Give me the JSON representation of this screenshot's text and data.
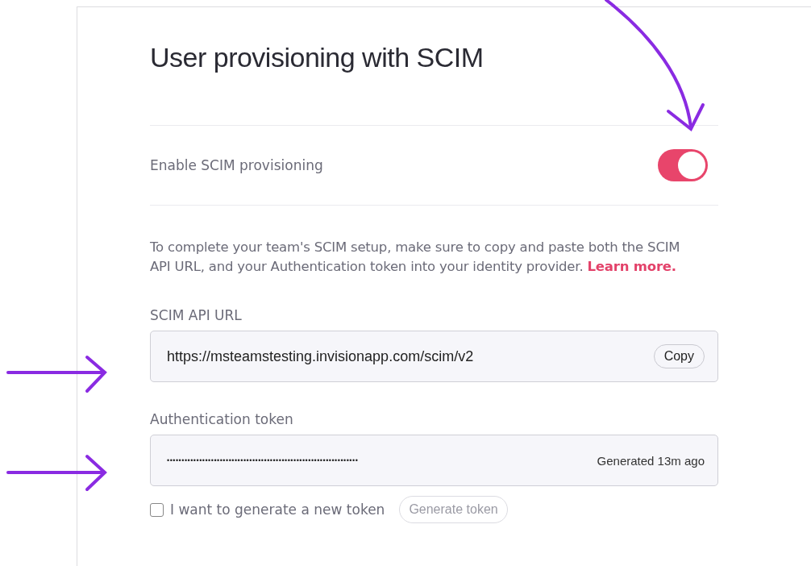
{
  "title": "User provisioning with SCIM",
  "toggle": {
    "label": "Enable SCIM provisioning",
    "on": true
  },
  "description": {
    "text": "To complete your team's SCIM setup, make sure to copy and paste both the SCIM API URL, and your Authentication token into your identity provider.",
    "link": "Learn more."
  },
  "api_url": {
    "label": "SCIM API URL",
    "value": "https://msteamstesting.invisionapp.com/scim/v2",
    "button": "Copy"
  },
  "token": {
    "label": "Authentication token",
    "value": "•••••••••••••••••••••••••••••••••••••••••••••••••••••••••••••••••",
    "status": "Generated 13m ago"
  },
  "regenerate": {
    "label": "I want to generate a new token",
    "checked": false,
    "button": "Generate token",
    "disabled": true
  }
}
